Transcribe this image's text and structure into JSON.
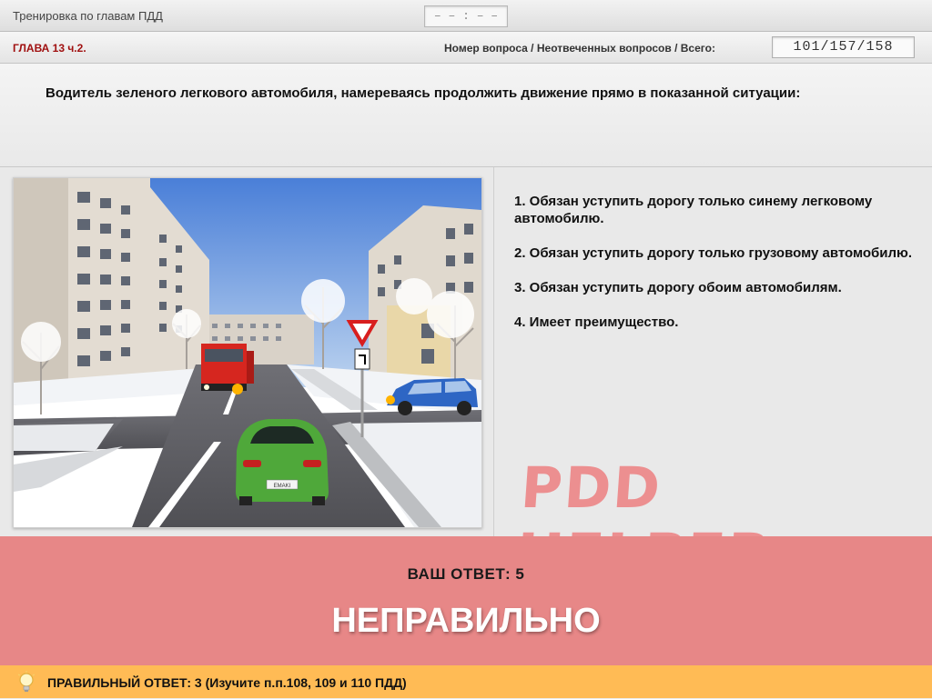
{
  "header": {
    "title": "Тренировка по главам ПДД",
    "timer": "– – : – –"
  },
  "info": {
    "chapter": "ГЛАВА 13 ч.2.",
    "counter_label": "Номер вопроса / Неотвеченных вопросов / Всего:",
    "counter_value": "101/157/158"
  },
  "question": {
    "text": "Водитель зеленого легкового автомобиля, намереваясь продолжить движение прямо в показанной ситуации:"
  },
  "answers": [
    {
      "label": "1.  Обязан уступить дорогу только синему легковому автомобилю."
    },
    {
      "label": "2.  Обязан уступить дорогу только грузовому автомобилю."
    },
    {
      "label": "3.  Обязан уступить дорогу обоим автомобилям."
    },
    {
      "label": "4.  Имеет преимущество."
    }
  ],
  "watermark": "PDD HELPER",
  "result": {
    "your_answer": "ВАШ  ОТВЕТ:   5",
    "verdict": "НЕПРАВИЛЬНО"
  },
  "correct": {
    "text": "ПРАВИЛЬНЫЙ ОТВЕТ:   3   (Изучите п.п.108, 109 и 110 ПДД)",
    "icon": "lightbulb-icon"
  },
  "scene": {
    "plate": "EMAKI"
  },
  "colors": {
    "result_bg": "#e78787",
    "correct_bg": "#ffbb55",
    "chapter": "#a01010",
    "watermark": "#ec8f90"
  }
}
